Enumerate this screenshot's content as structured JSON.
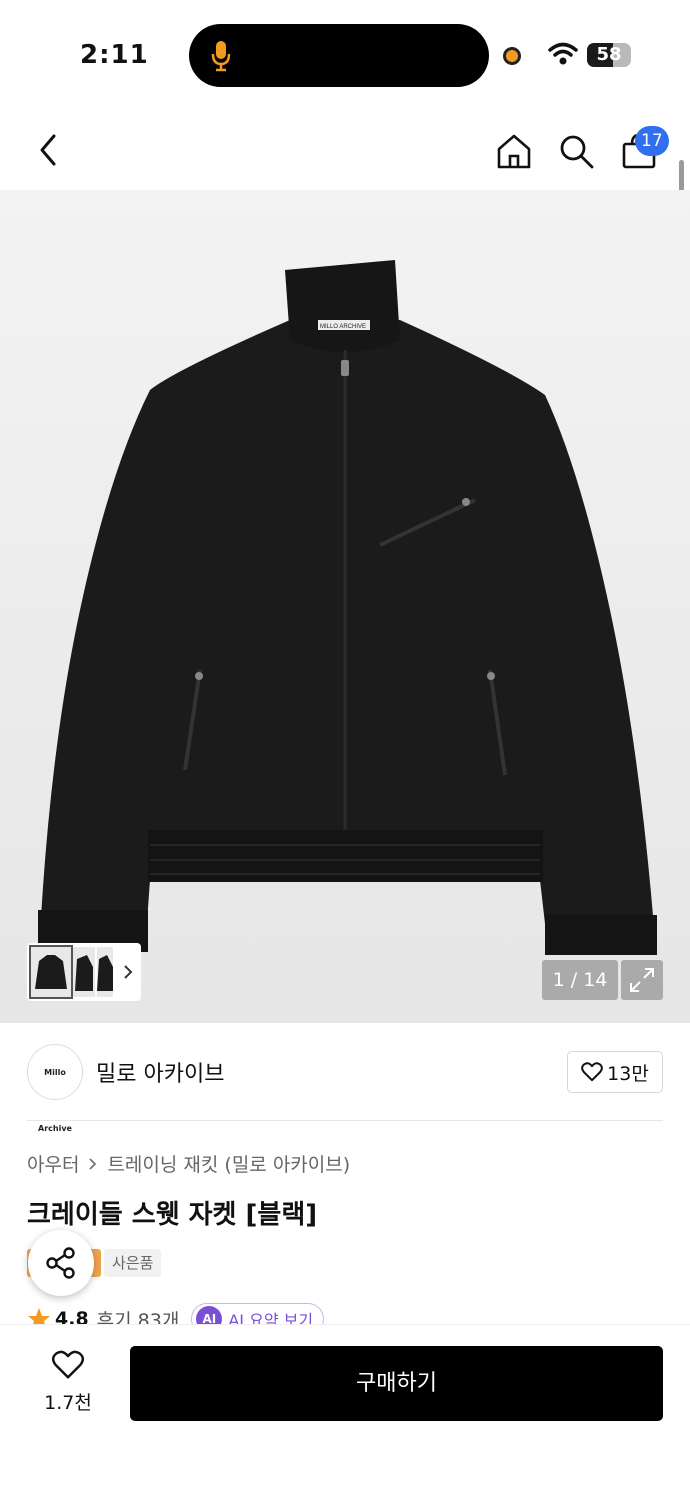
{
  "status_bar": {
    "time": "2:11",
    "battery": "58",
    "battery_level": 0.58
  },
  "nav": {
    "cart_count": "17"
  },
  "gallery": {
    "counter": "1 / 14",
    "jacket_label": "MILLO ARCHIVE"
  },
  "brand": {
    "logo_text": "Millo Archive",
    "name": "밀로 아카이브",
    "likes": "13만"
  },
  "breadcrumb": {
    "category": "아우터",
    "subcategory": "트레이닝 재킷 (밀로 아카이브)"
  },
  "product": {
    "title": "크레이들 스웻 자켓 [블랙]",
    "gift_tag": "사은품"
  },
  "rating": {
    "score": "4.8",
    "reviews": "후기 83개",
    "ai_badge": "AI",
    "ai_summary": "AI 요약 보기"
  },
  "bottom_bar": {
    "wish_count": "1.7천",
    "buy_label": "구매하기"
  },
  "colors": {
    "accent_blue": "#2f6ff0",
    "ai_purple": "#7a4fd6",
    "star": "#f29a21"
  }
}
